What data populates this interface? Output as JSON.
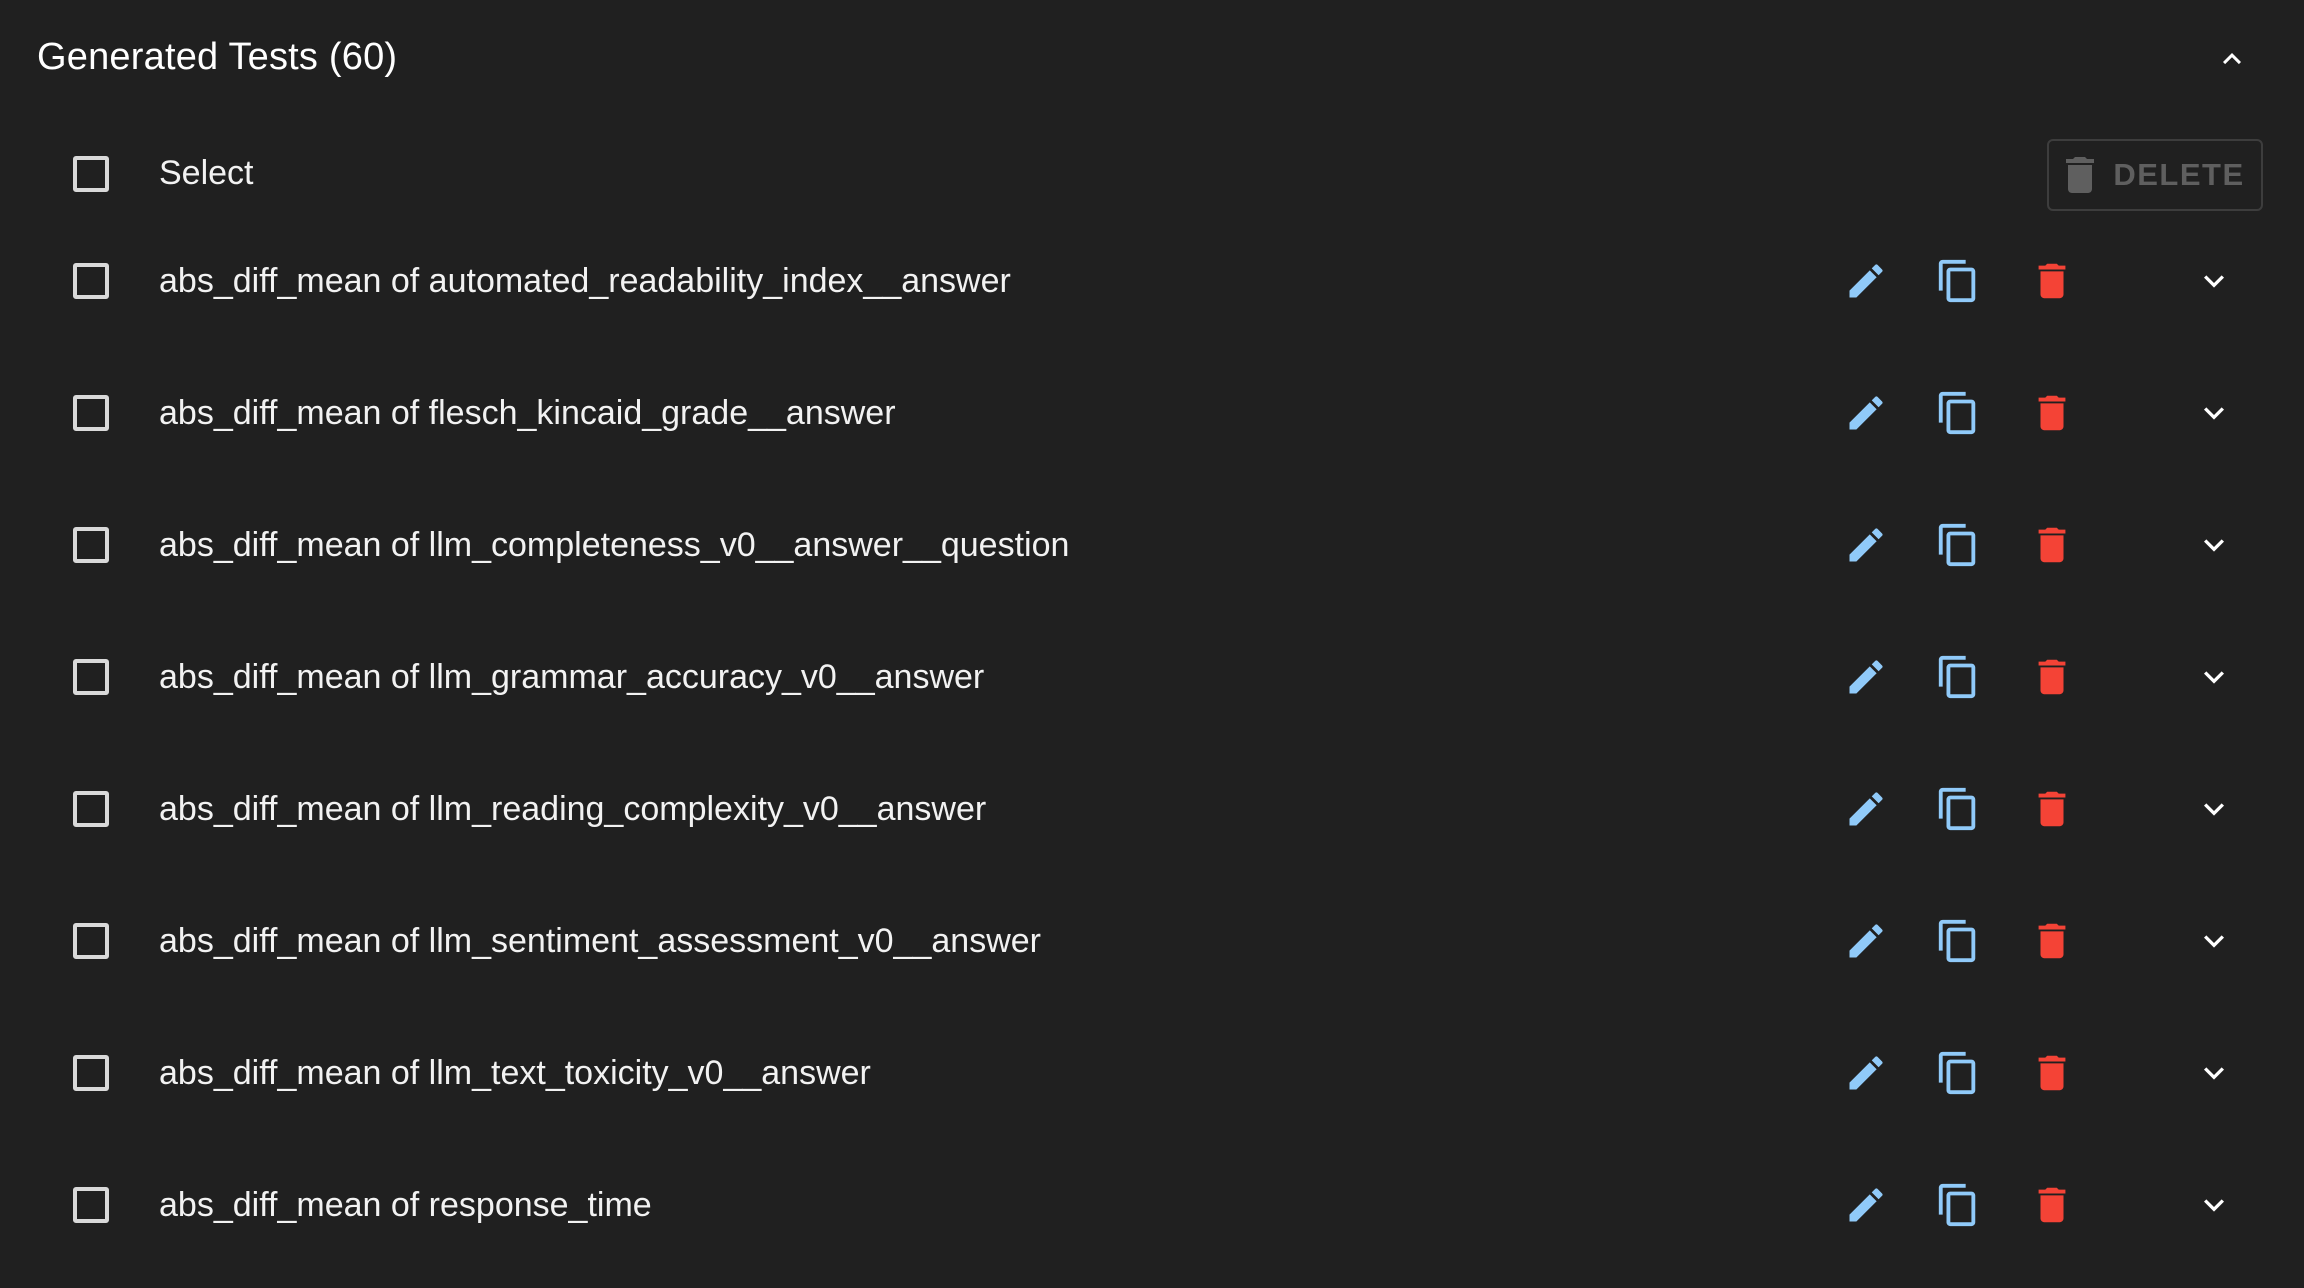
{
  "header": {
    "title": "Generated Tests (60)"
  },
  "select_bar": {
    "label": "Select",
    "delete_label": "DELETE"
  },
  "tests": [
    {
      "name": "abs_diff_mean of automated_readability_index__answer"
    },
    {
      "name": "abs_diff_mean of flesch_kincaid_grade__answer"
    },
    {
      "name": "abs_diff_mean of llm_completeness_v0__answer__question"
    },
    {
      "name": "abs_diff_mean of llm_grammar_accuracy_v0__answer"
    },
    {
      "name": "abs_diff_mean of llm_reading_complexity_v0__answer"
    },
    {
      "name": "abs_diff_mean of llm_sentiment_assessment_v0__answer"
    },
    {
      "name": "abs_diff_mean of llm_text_toxicity_v0__answer"
    },
    {
      "name": "abs_diff_mean of response_time"
    }
  ],
  "icons": {
    "collapse": "chevron-up-icon",
    "expand": "chevron-down-icon",
    "edit": "pencil-icon",
    "duplicate": "copy-icon",
    "delete": "trash-icon"
  },
  "colors": {
    "background": "#202020",
    "edit_icon": "#90caf9",
    "delete_icon": "#f44336",
    "disabled": "#5f5f5f"
  }
}
